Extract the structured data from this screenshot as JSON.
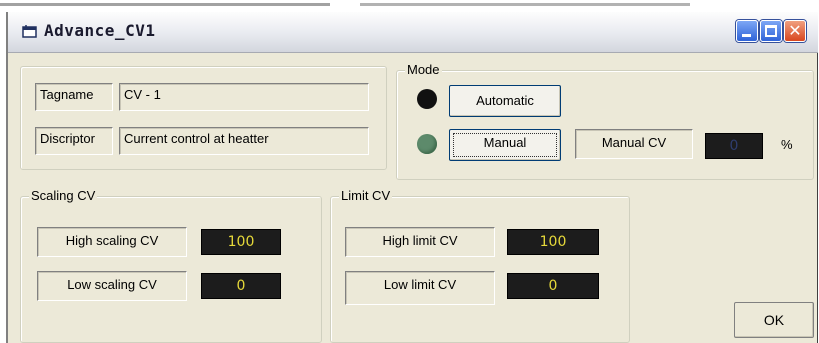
{
  "window": {
    "title": "Advance_CV1",
    "controls": {
      "min": "minimize",
      "max": "maximize",
      "close": "close"
    }
  },
  "tag": {
    "tagname_label": "Tagname",
    "tagname_value": "CV - 1",
    "descriptor_label": "Discriptor",
    "descriptor_value": "Current control at heatter"
  },
  "mode": {
    "legend": "Mode",
    "automatic_label": "Automatic",
    "manual_label": "Manual",
    "manual_cv_label": "Manual CV",
    "manual_cv_value": "0",
    "percent": "%",
    "led_colors": {
      "automatic": "#111111",
      "manual": "#5d8a6b"
    }
  },
  "scaling": {
    "legend": "Scaling CV",
    "high_label": "High scaling CV",
    "high_value": "100",
    "low_label": "Low scaling CV",
    "low_value": "0"
  },
  "limit": {
    "legend": "Limit CV",
    "high_label": "High limit CV",
    "high_value": "100",
    "low_label": "Low limit CV",
    "low_value": "0"
  },
  "ok_label": "OK",
  "colors": {
    "display_bg": "#1c1c1c",
    "display_text": "#e6d93a",
    "window_bg": "#ece9d8"
  }
}
